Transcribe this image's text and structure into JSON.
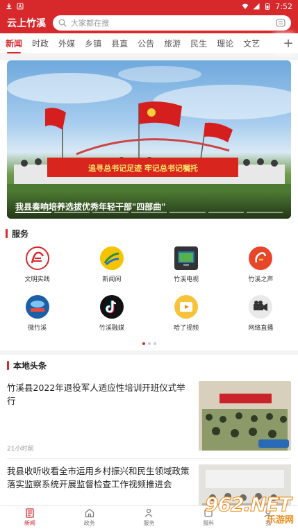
{
  "status_bar": {
    "time": "7:52",
    "left_icons": [
      "download-icon",
      "a-icon"
    ],
    "right_icons": [
      "wifi-icon",
      "signal-icon",
      "battery-icon"
    ]
  },
  "header": {
    "app_title": "云上竹溪",
    "search_placeholder": "大家都在搜",
    "brand_color": "#d7282b"
  },
  "tabs": [
    {
      "label": "新闻",
      "active": true
    },
    {
      "label": "时政"
    },
    {
      "label": "外媒"
    },
    {
      "label": "乡镇"
    },
    {
      "label": "县直"
    },
    {
      "label": "公告"
    },
    {
      "label": "旅游"
    },
    {
      "label": "民生"
    },
    {
      "label": "理论"
    },
    {
      "label": "文艺"
    }
  ],
  "banner": {
    "caption": "我县奏响培养选拔优秀年轻干部\"四部曲\"",
    "sign_text": "追寻总书记足迹  牢记总书记嘱托",
    "pages": 7,
    "active_page": 1
  },
  "services": {
    "title": "服务",
    "items": [
      {
        "label": "文明实践",
        "icon": "civilization-practice-icon"
      },
      {
        "label": "新闻闲",
        "icon": "news-leisure-icon"
      },
      {
        "label": "竹溪电视",
        "icon": "tv-icon"
      },
      {
        "label": "竹溪之声",
        "icon": "voice-icon"
      },
      {
        "label": "微竹溪",
        "icon": "micro-zhuxi-icon"
      },
      {
        "label": "竹溪融媒",
        "icon": "tiktok-icon"
      },
      {
        "label": "哈了视频",
        "icon": "video-play-icon"
      },
      {
        "label": "网络直播",
        "icon": "live-camera-icon"
      }
    ],
    "pages": 3,
    "active_page": 1
  },
  "local_news": {
    "title": "本地头条",
    "items": [
      {
        "title": "竹溪县2022年退役军人适应性培训开班仪式举行",
        "time": "21小时前"
      },
      {
        "title": "我县收听收看全市运用乡村振兴和民生领域政策落实监察系统开展监督检查工作视频推进会",
        "time": ""
      }
    ]
  },
  "bottom_nav": [
    {
      "label": "新闻",
      "icon": "news-icon",
      "active": true
    },
    {
      "label": "政务",
      "icon": "gov-icon"
    },
    {
      "label": "服务",
      "icon": "service-icon"
    },
    {
      "label": "报料",
      "icon": "report-icon"
    },
    {
      "label": "我",
      "icon": "user-icon"
    }
  ],
  "watermark": {
    "number": "962.NET",
    "site": "乐游网"
  }
}
